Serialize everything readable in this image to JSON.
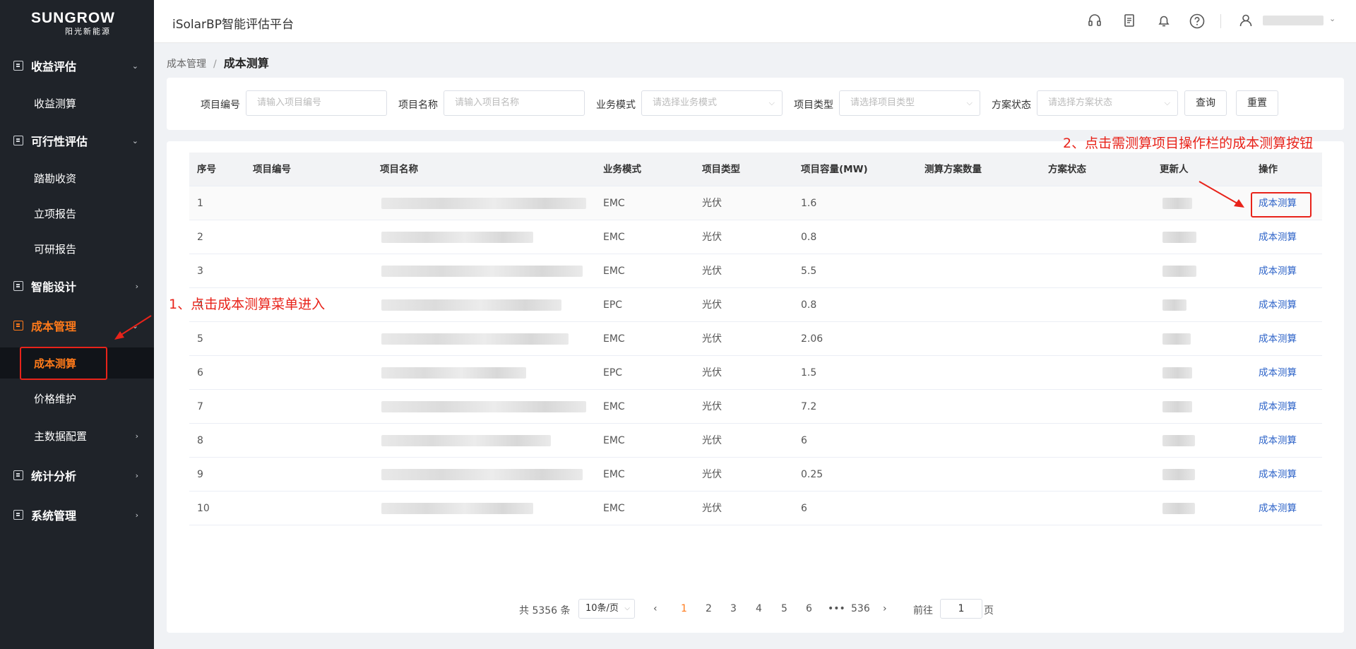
{
  "sidebar": {
    "logo_main": "SUNGROW",
    "logo_sub": "阳光新能源",
    "groups": [
      {
        "label": "收益评估",
        "arrow": "⌄"
      },
      {
        "label": "可行性评估",
        "arrow": "⌄"
      },
      {
        "label": "智能设计",
        "arrow": "›"
      },
      {
        "label": "成本管理",
        "arrow": "⌄"
      },
      {
        "label": "统计分析",
        "arrow": "›"
      },
      {
        "label": "系统管理",
        "arrow": "›"
      }
    ],
    "subitems": [
      {
        "label": "收益测算"
      },
      {
        "label": "踏勘收资"
      },
      {
        "label": "立项报告"
      },
      {
        "label": "可研报告"
      },
      {
        "label": "成本测算"
      },
      {
        "label": "价格维护"
      },
      {
        "label": "主数据配置",
        "arrow": "›"
      }
    ]
  },
  "header": {
    "app_title": "iSolarBP智能评估平台",
    "icons": [
      "headset-icon",
      "document-icon",
      "bell-icon",
      "help-icon",
      "user-icon"
    ]
  },
  "breadcrumb": {
    "parent": "成本管理",
    "separator": "/",
    "current": "成本测算"
  },
  "filters": {
    "project_no": {
      "label": "项目编号",
      "placeholder": "请输入项目编号"
    },
    "project_name": {
      "label": "项目名称",
      "placeholder": "请输入项目名称"
    },
    "business_mode": {
      "label": "业务模式",
      "placeholder": "请选择业务模式"
    },
    "project_type": {
      "label": "项目类型",
      "placeholder": "请选择项目类型"
    },
    "plan_status": {
      "label": "方案状态",
      "placeholder": "请选择方案状态"
    },
    "query_label": "查询",
    "reset_label": "重置"
  },
  "table": {
    "headers": [
      "序号",
      "项目编号",
      "项目名称",
      "业务模式",
      "项目类型",
      "项目容量(MW)",
      "测算方案数量",
      "方案状态",
      "更新人",
      "操作"
    ],
    "rows": [
      {
        "no": "1",
        "mode": "EMC",
        "type": "光伏",
        "capacity": "1.6",
        "action": "成本测算"
      },
      {
        "no": "2",
        "mode": "EMC",
        "type": "光伏",
        "capacity": "0.8",
        "action": "成本测算"
      },
      {
        "no": "3",
        "mode": "EMC",
        "type": "光伏",
        "capacity": "5.5",
        "action": "成本测算"
      },
      {
        "no": "4",
        "mode": "EPC",
        "type": "光伏",
        "capacity": "0.8",
        "action": "成本测算"
      },
      {
        "no": "5",
        "mode": "EMC",
        "type": "光伏",
        "capacity": "2.06",
        "action": "成本测算"
      },
      {
        "no": "6",
        "mode": "EPC",
        "type": "光伏",
        "capacity": "1.5",
        "action": "成本测算"
      },
      {
        "no": "7",
        "mode": "EMC",
        "type": "光伏",
        "capacity": "7.2",
        "action": "成本测算"
      },
      {
        "no": "8",
        "mode": "EMC",
        "type": "光伏",
        "capacity": "6",
        "action": "成本测算"
      },
      {
        "no": "9",
        "mode": "EMC",
        "type": "光伏",
        "capacity": "0.25",
        "action": "成本测算"
      },
      {
        "no": "10",
        "mode": "EMC",
        "type": "光伏",
        "capacity": "6",
        "action": "成本测算"
      }
    ]
  },
  "pagination": {
    "total": "共 5356 条",
    "page_size": "10条/页",
    "prev": "‹",
    "pages": [
      "1",
      "2",
      "3",
      "4",
      "5",
      "6",
      "•••",
      "536"
    ],
    "next": "›",
    "goto_label": "前往",
    "goto_value": "1",
    "goto_unit": "页"
  },
  "annotations": {
    "step1": "1、点击成本测算菜单进入",
    "step2": "2、点击需测算项目操作栏的成本测算按钮"
  },
  "colors": {
    "accent": "#ff7a1a",
    "sidebar_bg": "#1f2329",
    "link": "#2d63c8",
    "annotation": "#e8231a"
  }
}
